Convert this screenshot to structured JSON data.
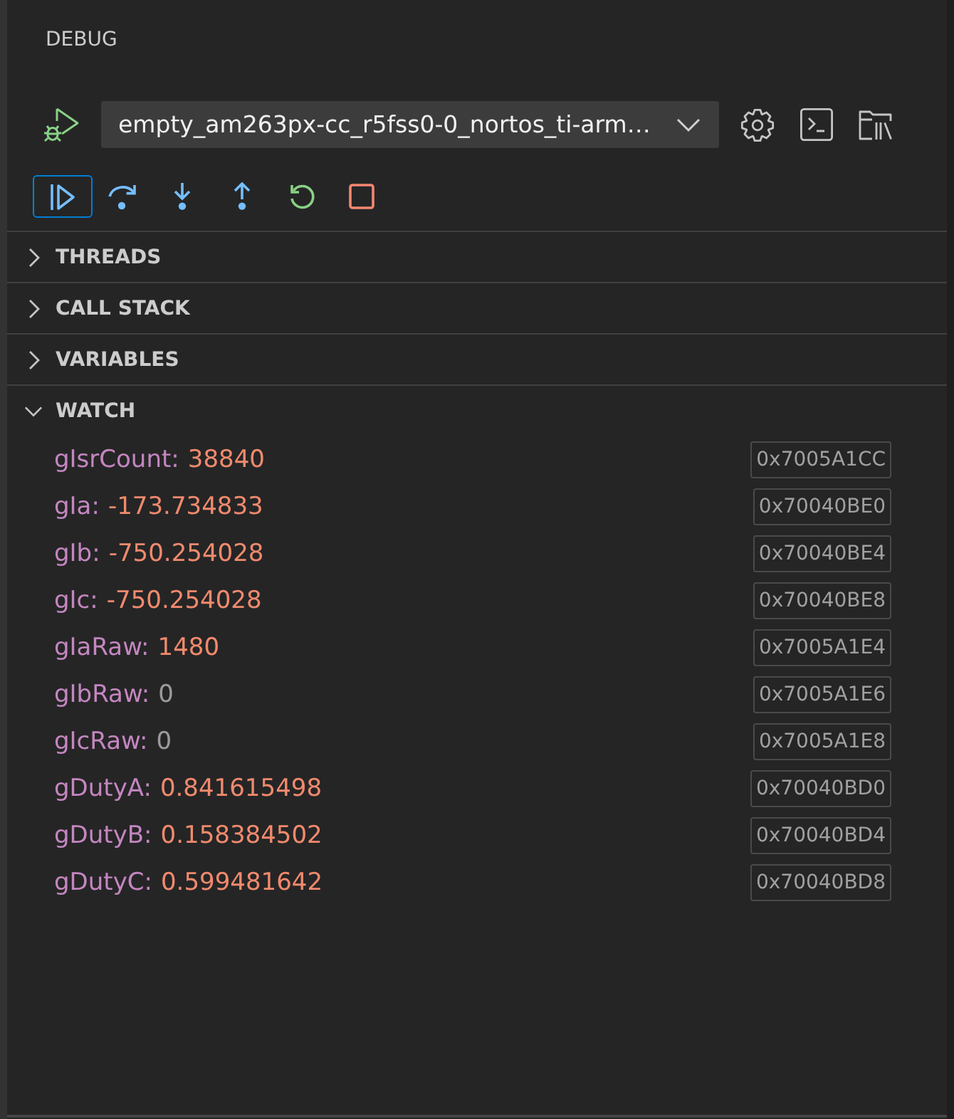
{
  "panel": {
    "title": "DEBUG"
  },
  "launch": {
    "configuration": "empty_am263px-cc_r5fss0-0_nortos_ti-arm…"
  },
  "debug_actions": [
    {
      "kind": "continue",
      "focused": true
    },
    {
      "kind": "step-over",
      "focused": false
    },
    {
      "kind": "step-into",
      "focused": false
    },
    {
      "kind": "step-out",
      "focused": false
    },
    {
      "kind": "restart",
      "focused": false
    },
    {
      "kind": "stop",
      "focused": false
    }
  ],
  "sections": [
    {
      "title": "THREADS",
      "expanded": false
    },
    {
      "title": "CALL STACK",
      "expanded": false
    },
    {
      "title": "VARIABLES",
      "expanded": false
    },
    {
      "title": "WATCH",
      "expanded": true,
      "items": [
        {
          "name": "gIsrCount:",
          "value": "38840",
          "address": "0x7005A1CC",
          "changed": true
        },
        {
          "name": "gIa:",
          "value": "-173.734833",
          "address": "0x70040BE0",
          "changed": true
        },
        {
          "name": "gIb:",
          "value": "-750.254028",
          "address": "0x70040BE4",
          "changed": true
        },
        {
          "name": "gIc:",
          "value": "-750.254028",
          "address": "0x70040BE8",
          "changed": true
        },
        {
          "name": "gIaRaw:",
          "value": "1480",
          "address": "0x7005A1E4",
          "changed": true
        },
        {
          "name": "gIbRaw:",
          "value": "0",
          "address": "0x7005A1E6",
          "changed": false
        },
        {
          "name": "gIcRaw:",
          "value": "0",
          "address": "0x7005A1E8",
          "changed": false
        },
        {
          "name": "gDutyA:",
          "value": "0.841615498",
          "address": "0x70040BD0",
          "changed": true
        },
        {
          "name": "gDutyB:",
          "value": "0.158384502",
          "address": "0x70040BD4",
          "changed": true
        },
        {
          "name": "gDutyC:",
          "value": "0.599481642",
          "address": "0x70040BD8",
          "changed": true
        }
      ]
    }
  ]
}
